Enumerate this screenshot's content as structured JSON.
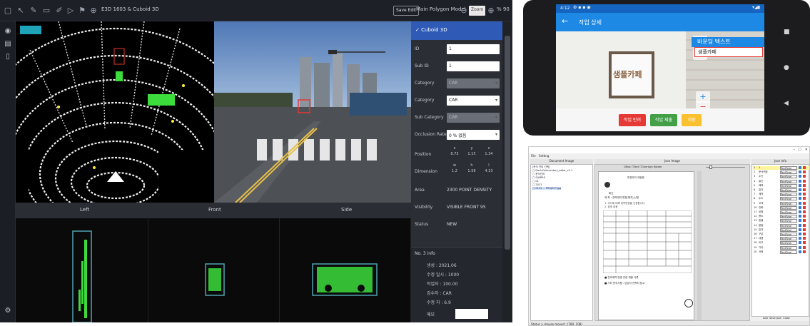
{
  "lidar_tool": {
    "window_title": "E3D 1603 & Cuboid 3D",
    "toolbar": {
      "mode_button": "Save Edit",
      "polygon_mode": "Main Polygon Model",
      "zoom_value": "Zoom",
      "zoom_unit": "% 90"
    },
    "views": {
      "left_label": "Left",
      "front_label": "Front",
      "side_label": "Side"
    },
    "panel": {
      "header": "✓ Cuboid 3D",
      "fields": [
        {
          "label": "ID",
          "value": "1",
          "type": "input"
        },
        {
          "label": "Sub ID",
          "value": "1",
          "type": "input"
        },
        {
          "label": "Category",
          "value": "CAR",
          "type": "select-disabled"
        },
        {
          "label": "Category",
          "value": "CAR",
          "type": "select"
        },
        {
          "label": "Sub Category",
          "value": "CAR",
          "type": "select-disabled"
        },
        {
          "label": "Occlusion Rate",
          "value": "0 % 없음",
          "type": "select"
        }
      ],
      "position": {
        "label": "Position",
        "heads": [
          "x",
          "y",
          "z"
        ],
        "values": [
          "8.73",
          "1.15",
          "1.34"
        ]
      },
      "dimension": {
        "label": "Dimension",
        "heads": [
          "w",
          "h",
          "l"
        ],
        "values": [
          "1.2",
          "1.58",
          "4.23"
        ]
      },
      "area": {
        "label": "Area",
        "value": "2300 POINT DENSITY"
      },
      "visibility": {
        "label": "Visibility",
        "value": "VISIBLE FRONT 95"
      },
      "status": {
        "label": "Status",
        "value": "NEW"
      },
      "info": {
        "header": "No. 3 info",
        "lines": [
          "생성 : 2021.06",
          "수정 일시 : 1000",
          "작업자 : 100.00",
          "검수자 : CAR",
          "수정 자 : 6.9"
        ],
        "input_label": "메모"
      }
    }
  },
  "phone_app": {
    "status_time": "4:12",
    "title": "작업 상세",
    "back_icon": "arrow-left-icon",
    "sign_text": "샘플카페",
    "bbox_label": "바운딩 텍스트",
    "bbox_value": "샘플카페",
    "buttons": [
      {
        "label": "작업 반려",
        "color": "#e53935"
      },
      {
        "label": "작업 제출",
        "color": "#43a047"
      },
      {
        "label": "저장",
        "color": "#fbc02d"
      }
    ]
  },
  "desktop_tool": {
    "menu": [
      "File",
      "Setting"
    ],
    "headers": {
      "doc_image": "Document Image",
      "json_image": "Json Image",
      "json_info": "Json Info"
    },
    "tree": [
      "[문서 관리 선택]",
      "▢ DocInfo/Inventory_edtor_v2.1",
      "  ▢ 문서관리",
      "    ▢ SAMPLE",
      "      ▢ 01",
      "        ▢ 2021",
      "          ▢ 0123 ... PROJECT.jpg"
    ],
    "viewer_options": {
      "box": "Box",
      "text": "Text",
      "overlays": "Overlays",
      "rotate": "Rotate"
    },
    "doc_lines": [
      "변경하여 재발행",
      "회신",
      "제 목 : 전력계약 변경(해지) 신청",
      "1. 귀사에 대해 계약변경을 신청합니다",
      "2. 상세 내용",
      "■ 전력계약 변경 관련 제출 서류",
      "■ 기타 문의사항 : 담당자 연락처 참고"
    ],
    "json_rows": [
      {
        "n": "1",
        "k": "1",
        "v": "TextType"
      },
      {
        "n": "2",
        "k": "문서번호",
        "v": "TextType"
      },
      {
        "n": "3",
        "k": "수신",
        "v": "TextType"
      },
      {
        "n": "4",
        "k": "발신",
        "v": "TextType"
      },
      {
        "n": "5",
        "k": "제목",
        "v": "TextType"
      },
      {
        "n": "6",
        "k": "일자",
        "v": "TextType"
      },
      {
        "n": "7",
        "k": "계약",
        "v": "TextType"
      },
      {
        "n": "8",
        "k": "주소",
        "v": "TextType"
      },
      {
        "n": "9",
        "k": "고객",
        "v": "TextType"
      },
      {
        "n": "10",
        "k": "전화",
        "v": "TextType"
      },
      {
        "n": "11",
        "k": "성명",
        "v": "TextType"
      },
      {
        "n": "12",
        "k": "용도",
        "v": "TextType"
      },
      {
        "n": "13",
        "k": "종별",
        "v": "TextType"
      },
      {
        "n": "14",
        "k": "용량",
        "v": "TextType"
      },
      {
        "n": "15",
        "k": "일자",
        "v": "TextType"
      },
      {
        "n": "16",
        "k": "구분",
        "v": "TextType"
      },
      {
        "n": "17",
        "k": "내용",
        "v": "TextType"
      },
      {
        "n": "18",
        "k": "비고",
        "v": "TextType"
      },
      {
        "n": "19",
        "k": "기타",
        "v": "TextType"
      },
      {
        "n": "20",
        "k": "서명",
        "v": "TextType"
      }
    ],
    "footer_buttons": [
      "Add",
      "Save Json",
      "Close"
    ],
    "status": "Status > mouse moved : (780, 108)"
  }
}
